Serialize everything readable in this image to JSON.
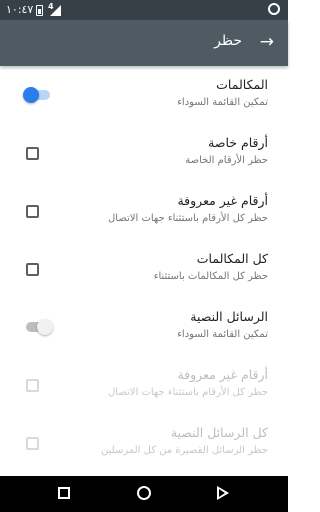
{
  "status_bar": {
    "time": "١٠:٤٧",
    "network": "4"
  },
  "app_bar": {
    "title": "حظر",
    "back_icon": "arrow-icon"
  },
  "settings": [
    {
      "title": "المكالمات",
      "subtitle": "تمكين القائمة السوداء",
      "control": "switch",
      "checked": true,
      "enabled": true
    },
    {
      "title": "أرقام خاصة",
      "subtitle": "حظر الأرقام الخاصة",
      "control": "checkbox",
      "checked": false,
      "enabled": true
    },
    {
      "title": "أرقام غير معروفة",
      "subtitle": "حظر كل الأرقام باستثناء جهات الاتصال",
      "control": "checkbox",
      "checked": false,
      "enabled": true
    },
    {
      "title": "كل المكالمات",
      "subtitle": "حظر كل المكالمات باستثناء",
      "control": "checkbox",
      "checked": false,
      "enabled": true
    },
    {
      "title": "الرسائل النصية",
      "subtitle": "تمكين القائمة السوداء",
      "control": "switch",
      "checked": false,
      "enabled": true
    },
    {
      "title": "أرقام غير معروفة",
      "subtitle": "حظر كل الأرقام باستثناء جهات الاتصال",
      "control": "checkbox",
      "checked": false,
      "enabled": false
    },
    {
      "title": "كل الرسائل النصية",
      "subtitle": "حظر الرسائل القصيرة من كل المرسلين",
      "control": "checkbox",
      "checked": false,
      "enabled": false
    }
  ],
  "colors": {
    "app_bar": "#4f5b62",
    "status_bar": "#374046",
    "accent": "#2b7de9"
  }
}
